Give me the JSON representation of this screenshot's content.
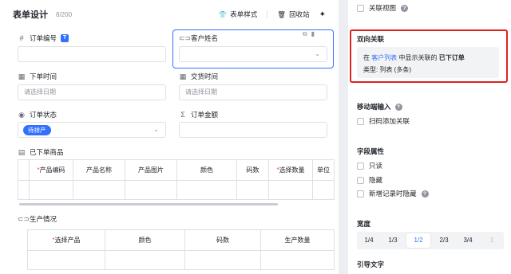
{
  "header": {
    "title": "表单设计",
    "count": "8/200",
    "style_button": "表单样式",
    "recycle_button": "回收站"
  },
  "fields": {
    "order_no": {
      "label": "订单编号",
      "badge": "T"
    },
    "customer": {
      "label": "客户姓名"
    },
    "order_time": {
      "label": "下单时间",
      "placeholder": "请选择日期"
    },
    "deal_time": {
      "label": "交货时间",
      "placeholder": "请选择日期"
    },
    "status": {
      "label": "订单状态",
      "value": "待排产"
    },
    "amount": {
      "label": "订单金额",
      "icon": "Σ"
    }
  },
  "ordered_products": {
    "label": "已下单商品",
    "columns": [
      "产品编码",
      "产品名称",
      "产品图片",
      "颜色",
      "码数",
      "选择数量",
      "单位"
    ],
    "required": [
      true,
      false,
      false,
      false,
      false,
      true,
      false
    ]
  },
  "production": {
    "label": "生产情况",
    "columns": [
      "选择产品",
      "颜色",
      "码数",
      "生产数量"
    ],
    "required": [
      true,
      false,
      false,
      false
    ]
  },
  "sidebar": {
    "related_view": "关联视图",
    "bidirectional": {
      "title": "双向关联",
      "line_prefix": "在",
      "line_link": "客户列表",
      "line_middle": "中显示关联的",
      "line_bold": "已下订单",
      "type_line": "类型: 列表 (多条)"
    },
    "mobile_input": {
      "title": "移动端输入",
      "scan_label": "扫码添加关联"
    },
    "field_props": {
      "title": "字段属性",
      "readonly": "只读",
      "hidden": "隐藏",
      "hide_on_new": "新增记录时隐藏"
    },
    "width": {
      "title": "宽度",
      "options": [
        "1/4",
        "1/3",
        "1/2",
        "2/3",
        "3/4",
        "1"
      ],
      "selected": "1/2"
    },
    "guide_text": {
      "title": "引导文字"
    }
  },
  "colors": {
    "accent": "#3370ff",
    "highlight": "#e02020",
    "required": "#f54a45"
  }
}
